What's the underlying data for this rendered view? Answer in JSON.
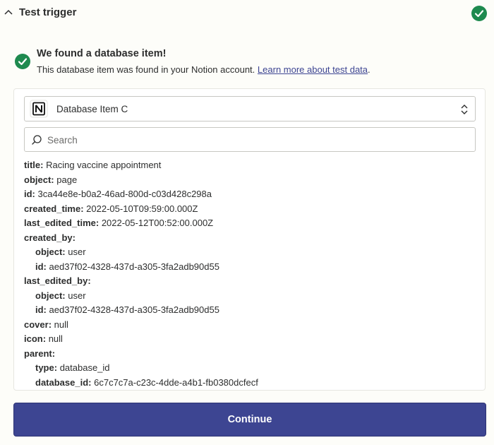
{
  "header": {
    "title": "Test trigger"
  },
  "result": {
    "title": "We found a database item!",
    "description": "This database item was found in your Notion account.",
    "link": "Learn more about test data",
    "period": "."
  },
  "select": {
    "value": "Database Item C"
  },
  "search": {
    "placeholder": "Search"
  },
  "fields": [
    {
      "key": "title:",
      "value": "Racing vaccine appointment",
      "level": 0
    },
    {
      "key": "object:",
      "value": "page",
      "level": 0
    },
    {
      "key": "id:",
      "value": "3ca44e8e-b0a2-46ad-800d-c03d428c298a",
      "level": 0
    },
    {
      "key": "created_time:",
      "value": "2022-05-10T09:59:00.000Z",
      "level": 0
    },
    {
      "key": "last_edited_time:",
      "value": "2022-05-12T00:52:00.000Z",
      "level": 0
    },
    {
      "key": "created_by:",
      "value": "",
      "level": 0
    },
    {
      "key": "object:",
      "value": "user",
      "level": 1
    },
    {
      "key": "id:",
      "value": "aed37f02-4328-437d-a305-3fa2adb90d55",
      "level": 1
    },
    {
      "key": "last_edited_by:",
      "value": "",
      "level": 0
    },
    {
      "key": "object:",
      "value": "user",
      "level": 1
    },
    {
      "key": "id:",
      "value": "aed37f02-4328-437d-a305-3fa2adb90d55",
      "level": 1
    },
    {
      "key": "cover:",
      "value": "null",
      "level": 0
    },
    {
      "key": "icon:",
      "value": "null",
      "level": 0
    },
    {
      "key": "parent:",
      "value": "",
      "level": 0
    },
    {
      "key": "type:",
      "value": "database_id",
      "level": 1
    },
    {
      "key": "database_id:",
      "value": "6c7c7c7a-c23c-4dde-a4b1-fb0380dcfecf",
      "level": 1
    }
  ],
  "continue_label": "Continue",
  "colors": {
    "success": "#1e8a4f",
    "primary": "#3d4592",
    "text": "#2d2e2e",
    "background": "#fdfdf9"
  },
  "icons": {
    "collapse": "chevron-up-icon",
    "status": "check-circle-icon",
    "app": "notion-logo-icon",
    "dropdown": "chevron-up-down-icon",
    "search": "search-icon"
  }
}
